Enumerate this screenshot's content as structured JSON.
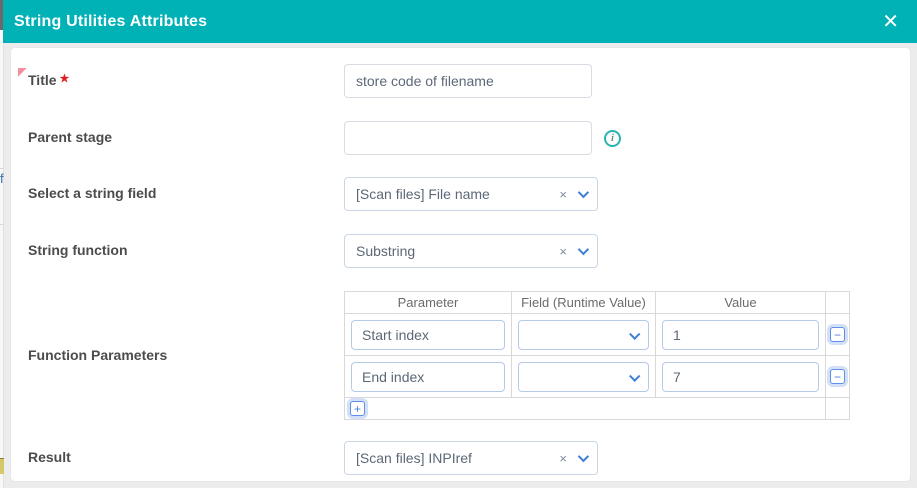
{
  "icons": {
    "close": "✕",
    "clear": "×",
    "remove_row": "−",
    "add_row": "+",
    "info": "i"
  },
  "background": {
    "left_fragment_text": "f"
  },
  "modal": {
    "title": "String Utilities Attributes"
  },
  "form": {
    "title_field": {
      "label": "Title",
      "required_marker": "★",
      "value": "store code of filename"
    },
    "parent_stage": {
      "label": "Parent stage",
      "value": ""
    },
    "string_field": {
      "label": "Select a string field",
      "value": "[Scan files] File name"
    },
    "string_function": {
      "label": "String function",
      "value": "Substring"
    },
    "function_parameters": {
      "label": "Function Parameters",
      "table": {
        "headers": [
          "Parameter",
          "Field (Runtime Value)",
          "Value"
        ],
        "rows": [
          {
            "parameter": "Start index",
            "field_runtime_value": "",
            "value": "1"
          },
          {
            "parameter": "End index",
            "field_runtime_value": "",
            "value": "7"
          }
        ]
      }
    },
    "result": {
      "label": "Result",
      "value": "[Scan files] INPIref"
    }
  },
  "colors": {
    "header_teal": "#00b1b6",
    "accent_blue": "#4a7fd4",
    "required_red": "#e02020",
    "flag_pink": "#f2909f"
  }
}
